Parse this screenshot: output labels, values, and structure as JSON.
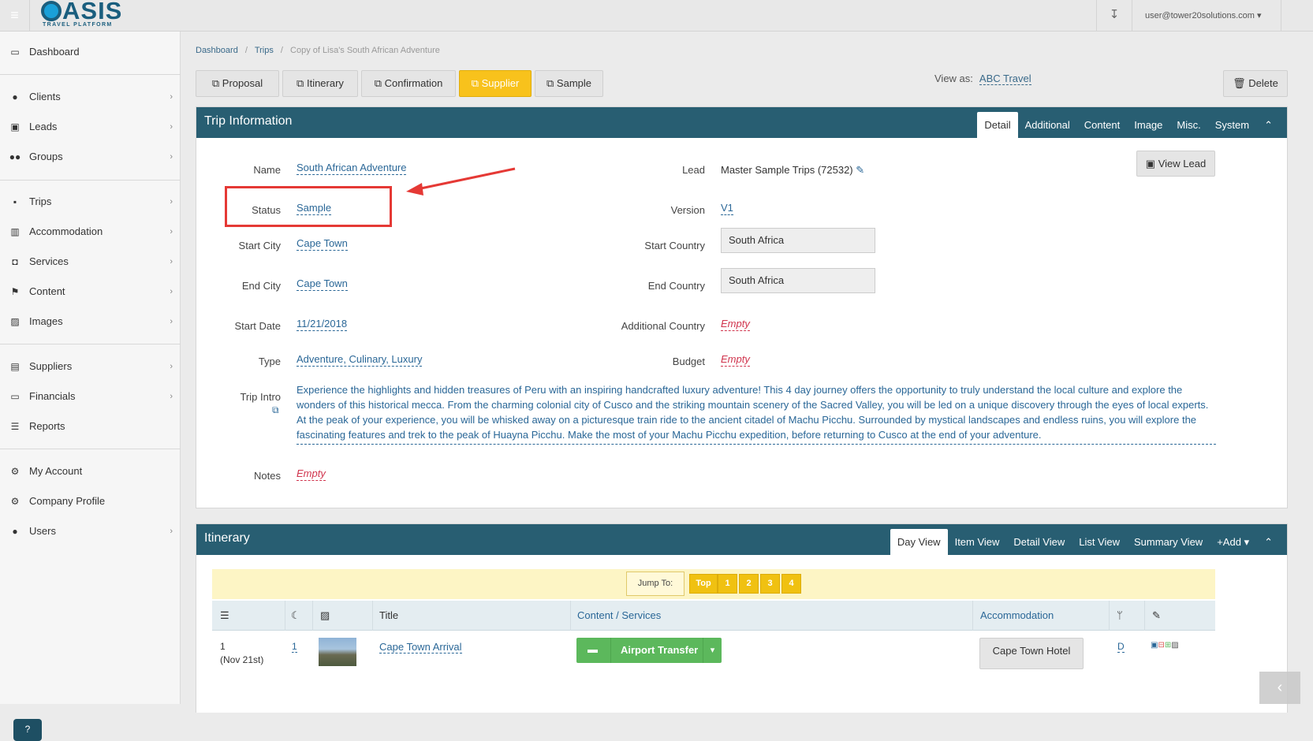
{
  "topbar": {
    "logo_main": "ASIS",
    "logo_sub": "TRAVEL PLATFORM",
    "user": "user@tower20solutions.com"
  },
  "sidebar": {
    "items": [
      {
        "label": "Dashboard",
        "icon": "desktop-icon"
      },
      {
        "label": "Clients",
        "icon": "user-icon"
      },
      {
        "label": "Leads",
        "icon": "inbox-icon"
      },
      {
        "label": "Groups",
        "icon": "users-icon"
      },
      {
        "label": "Trips",
        "icon": "suitcase-icon"
      },
      {
        "label": "Accommodation",
        "icon": "building-icon"
      },
      {
        "label": "Services",
        "icon": "binoculars-icon"
      },
      {
        "label": "Content",
        "icon": "flag-icon"
      },
      {
        "label": "Images",
        "icon": "image-icon"
      },
      {
        "label": "Suppliers",
        "icon": "book-icon"
      },
      {
        "label": "Financials",
        "icon": "money-icon"
      },
      {
        "label": "Reports",
        "icon": "list-icon"
      },
      {
        "label": "My Account",
        "icon": "gear-icon"
      },
      {
        "label": "Company Profile",
        "icon": "gears-icon"
      },
      {
        "label": "Users",
        "icon": "user-icon"
      }
    ],
    "help": "?"
  },
  "breadcrumb": [
    "Dashboard",
    "Trips",
    "Copy of Lisa's South African Adventure"
  ],
  "toolbar": {
    "buttons": [
      "Proposal",
      "Itinerary",
      "Confirmation",
      "Supplier",
      "Sample"
    ],
    "active": "Supplier",
    "view_as_label": "View as:",
    "view_as_value": "ABC Travel",
    "delete": "Delete"
  },
  "trip_info": {
    "title": "Trip Information",
    "tabs": [
      "Detail",
      "Additional",
      "Content",
      "Image",
      "Misc.",
      "System"
    ],
    "active_tab": "Detail",
    "fields": {
      "name_label": "Name",
      "name": "South African Adventure",
      "status_label": "Status",
      "status": "Sample",
      "start_city_label": "Start City",
      "start_city": "Cape Town",
      "end_city_label": "End City",
      "end_city": "Cape Town",
      "start_date_label": "Start Date",
      "start_date": "11/21/2018",
      "type_label": "Type",
      "type": "Adventure, Culinary, Luxury",
      "trip_intro_label": "Trip Intro",
      "trip_intro": "Experience the highlights and hidden treasures of Peru with an inspiring handcrafted luxury adventure! This  4 day journey offers the opportunity to truly understand the local culture and explore the wonders of this historical mecca. From the charming colonial city of Cusco and the striking mountain scenery of the Sacred Valley, you will be led on a unique discovery through the eyes of local experts. At the peak of your experience, you will be whisked away on a picturesque train ride to the ancient citadel of Machu Picchu. Surrounded by mystical landscapes and endless ruins, you will explore the fascinating features and trek to the peak of Huayna Picchu. Make the most of your Machu Picchu expedition, before returning to Cusco at the end of your adventure.",
      "notes_label": "Notes",
      "notes": "Empty",
      "lead_label": "Lead",
      "lead": "Master Sample Trips (72532)",
      "version_label": "Version",
      "version": "V1",
      "start_country_label": "Start Country",
      "start_country": "South Africa",
      "end_country_label": "End Country",
      "end_country": "South Africa",
      "additional_country_label": "Additional Country",
      "additional_country": "Empty",
      "budget_label": "Budget",
      "budget": "Empty",
      "view_lead": "View Lead"
    }
  },
  "itinerary": {
    "title": "Itinerary",
    "tabs": [
      "Day View",
      "Item View",
      "Detail View",
      "List View",
      "Summary View",
      "Add"
    ],
    "active_tab": "Day View",
    "jump_label": "Jump To:",
    "jump_buttons": [
      "Top",
      "1",
      "2",
      "3",
      "4"
    ],
    "columns": [
      "Title",
      "Content / Services",
      "Accommodation"
    ],
    "rows": [
      {
        "num": "1",
        "date": "(Nov 21st)",
        "nights": "1",
        "title": "Cape Town Arrival",
        "service": "Airport Transfer",
        "hotel": "Cape Town Hotel",
        "meal": "D"
      }
    ]
  },
  "colors": {
    "accent": "#f8c21c",
    "panel_header": "#285e72",
    "link": "#2a6797",
    "empty": "#d0344d",
    "highlight": "#e53935",
    "service_green": "#5cb85c"
  }
}
